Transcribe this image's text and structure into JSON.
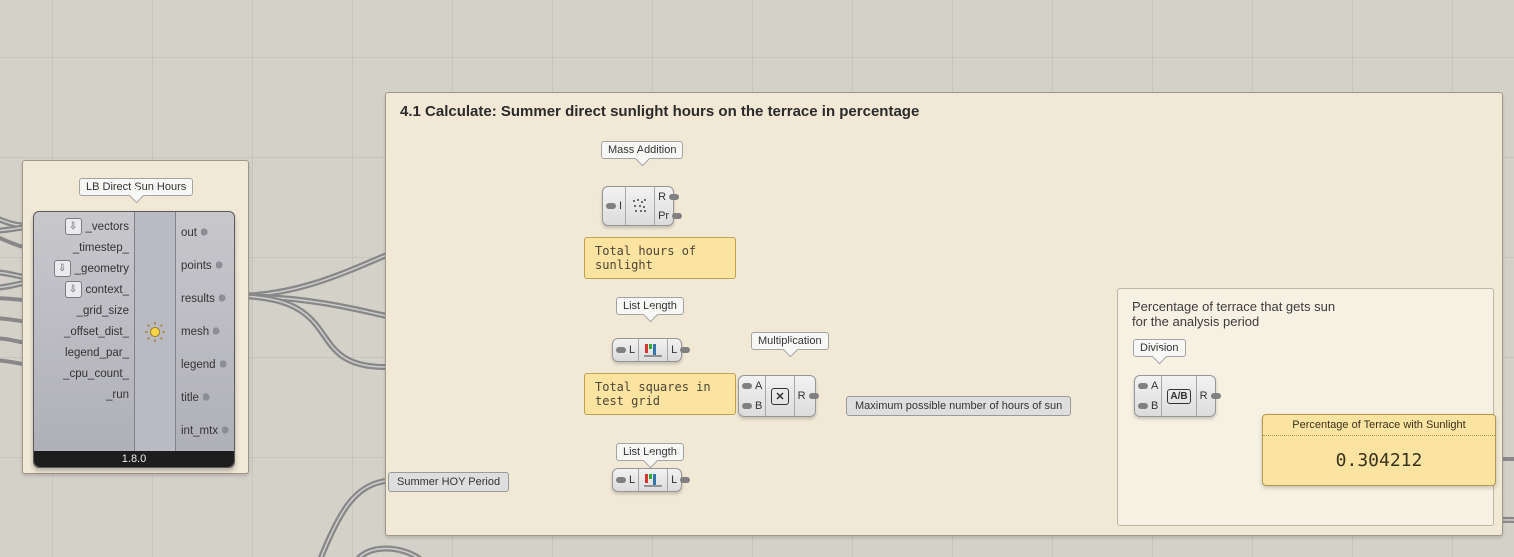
{
  "group_main": {
    "title": "4.1 Calculate: Summer direct sunlight hours on the terrace in percentage",
    "division_sub": "Percentage of terrace that gets sun for the analysis period"
  },
  "lb_component": {
    "label": "LB Direct Sun Hours",
    "version": "1.8.0",
    "inputs": [
      "_vectors",
      "_timestep_",
      "_geometry",
      "context_",
      "_grid_size",
      "_offset_dist_",
      "legend_par_",
      "_cpu_count_",
      "_run"
    ],
    "outputs": [
      "out",
      "points",
      "results",
      "mesh",
      "legend",
      "title",
      "int_mtx"
    ],
    "icon_alt": "sun-icon"
  },
  "components": {
    "mass_addition": {
      "label": "Mass Addition",
      "inputs": [
        "I"
      ],
      "outputs": [
        "R",
        "Pr"
      ]
    },
    "list_length_1": {
      "label": "List Length",
      "inputs": [
        "L"
      ],
      "outputs": [
        "L"
      ]
    },
    "list_length_2": {
      "label": "List Length",
      "inputs": [
        "L"
      ],
      "outputs": [
        "L"
      ]
    },
    "multiplication": {
      "label": "Multiplication",
      "inputs": [
        "A",
        "B"
      ],
      "outputs": [
        "R"
      ]
    },
    "division": {
      "label": "Division",
      "inputs": [
        "A",
        "B"
      ],
      "outputs": [
        "R"
      ]
    }
  },
  "relays": {
    "summer_hoy": "Summer HOY Period",
    "max_possible": "Maximum possible number of hours of sun"
  },
  "notes": {
    "total_hours_sunlight": "Total hours of sunlight",
    "total_squares_grid": "Total squares in test grid"
  },
  "result_panel": {
    "title": "Percentage of Terrace with Sunlight",
    "value": "0.304212"
  }
}
